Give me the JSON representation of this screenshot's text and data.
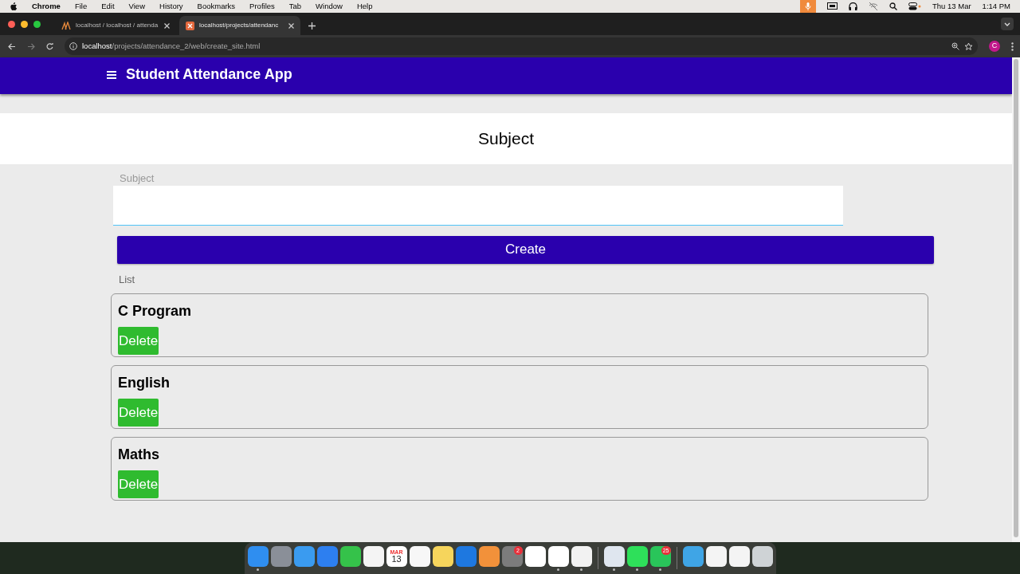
{
  "menubar": {
    "app": "Chrome",
    "menus": [
      "File",
      "Edit",
      "View",
      "History",
      "Bookmarks",
      "Profiles",
      "Tab",
      "Window",
      "Help"
    ],
    "date": "Thu 13 Mar",
    "time": "1:14 PM"
  },
  "browser": {
    "tabs": [
      {
        "title": "localhost / localhost / attenda",
        "selected": false
      },
      {
        "title": "localhost/projects/attendanc",
        "selected": true
      }
    ],
    "address_host": "localhost",
    "address_path": "/projects/attendance_2/web/create_site.html",
    "profile": "C"
  },
  "app": {
    "title": "Student Attendance App",
    "heading": "Subject",
    "field_label": "Subject",
    "create_button": "Create",
    "list_label": "List",
    "subjects": [
      {
        "name": "C Program",
        "action": "Delete"
      },
      {
        "name": "English",
        "action": "Delete"
      },
      {
        "name": "Maths",
        "action": "Delete"
      }
    ]
  },
  "dock": {
    "items": [
      {
        "kind": "finder",
        "running": true
      },
      {
        "kind": "launchpad",
        "running": false
      },
      {
        "kind": "safari",
        "running": false
      },
      {
        "kind": "mail",
        "running": false
      },
      {
        "kind": "messages",
        "running": false
      },
      {
        "kind": "photos",
        "running": false
      },
      {
        "kind": "calendar",
        "running": false,
        "month": "MAR",
        "day": "13"
      },
      {
        "kind": "reminders",
        "running": false
      },
      {
        "kind": "notes",
        "running": false
      },
      {
        "kind": "keynote",
        "running": false
      },
      {
        "kind": "pages",
        "running": false
      },
      {
        "kind": "settings",
        "running": false,
        "badge": "2"
      },
      {
        "kind": "mongo",
        "running": false
      },
      {
        "kind": "vscode",
        "running": true
      },
      {
        "kind": "chrome",
        "running": true
      },
      {
        "kind": "divider"
      },
      {
        "kind": "gear",
        "running": true
      },
      {
        "kind": "terminal",
        "running": true
      },
      {
        "kind": "whatsapp",
        "running": true,
        "badge": "25"
      },
      {
        "kind": "divider"
      },
      {
        "kind": "folder",
        "running": false
      },
      {
        "kind": "window",
        "running": false
      },
      {
        "kind": "window",
        "running": false
      },
      {
        "kind": "trash",
        "running": false
      }
    ]
  }
}
